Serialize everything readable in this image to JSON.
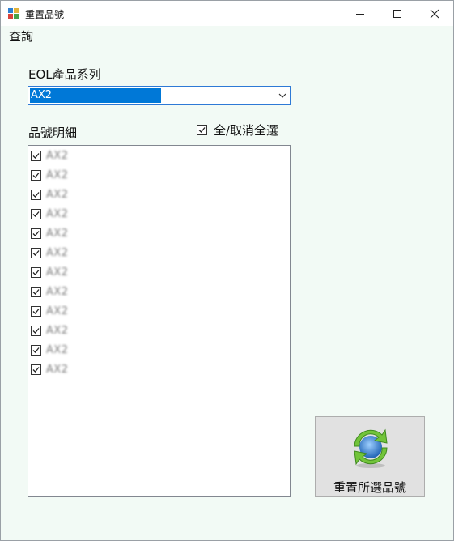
{
  "window": {
    "title": "重置品號"
  },
  "group": {
    "label": "查詢"
  },
  "series": {
    "label": "EOL產品系列",
    "selected": "AX2"
  },
  "details": {
    "label": "品號明細",
    "select_all_label": "全/取消全選",
    "select_all_checked": true,
    "items": [
      {
        "text": "AX2",
        "checked": true
      },
      {
        "text": "AX2",
        "checked": true
      },
      {
        "text": "AX2",
        "checked": true
      },
      {
        "text": "AX2",
        "checked": true
      },
      {
        "text": "AX2",
        "checked": true
      },
      {
        "text": "AX2",
        "checked": true
      },
      {
        "text": "AX2",
        "checked": true
      },
      {
        "text": "AX2",
        "checked": true
      },
      {
        "text": "AX2",
        "checked": true
      },
      {
        "text": "AX2",
        "checked": true
      },
      {
        "text": "AX2",
        "checked": true
      },
      {
        "text": "AX2",
        "checked": true
      }
    ]
  },
  "actions": {
    "reset_label": "重置所選品號",
    "reset_icon": "refresh-arrows-icon"
  },
  "colors": {
    "form_background": "#f2faf5",
    "selection": "#0078d7",
    "icon_green": "#6fc23a",
    "icon_blue": "#2f7fd0"
  }
}
